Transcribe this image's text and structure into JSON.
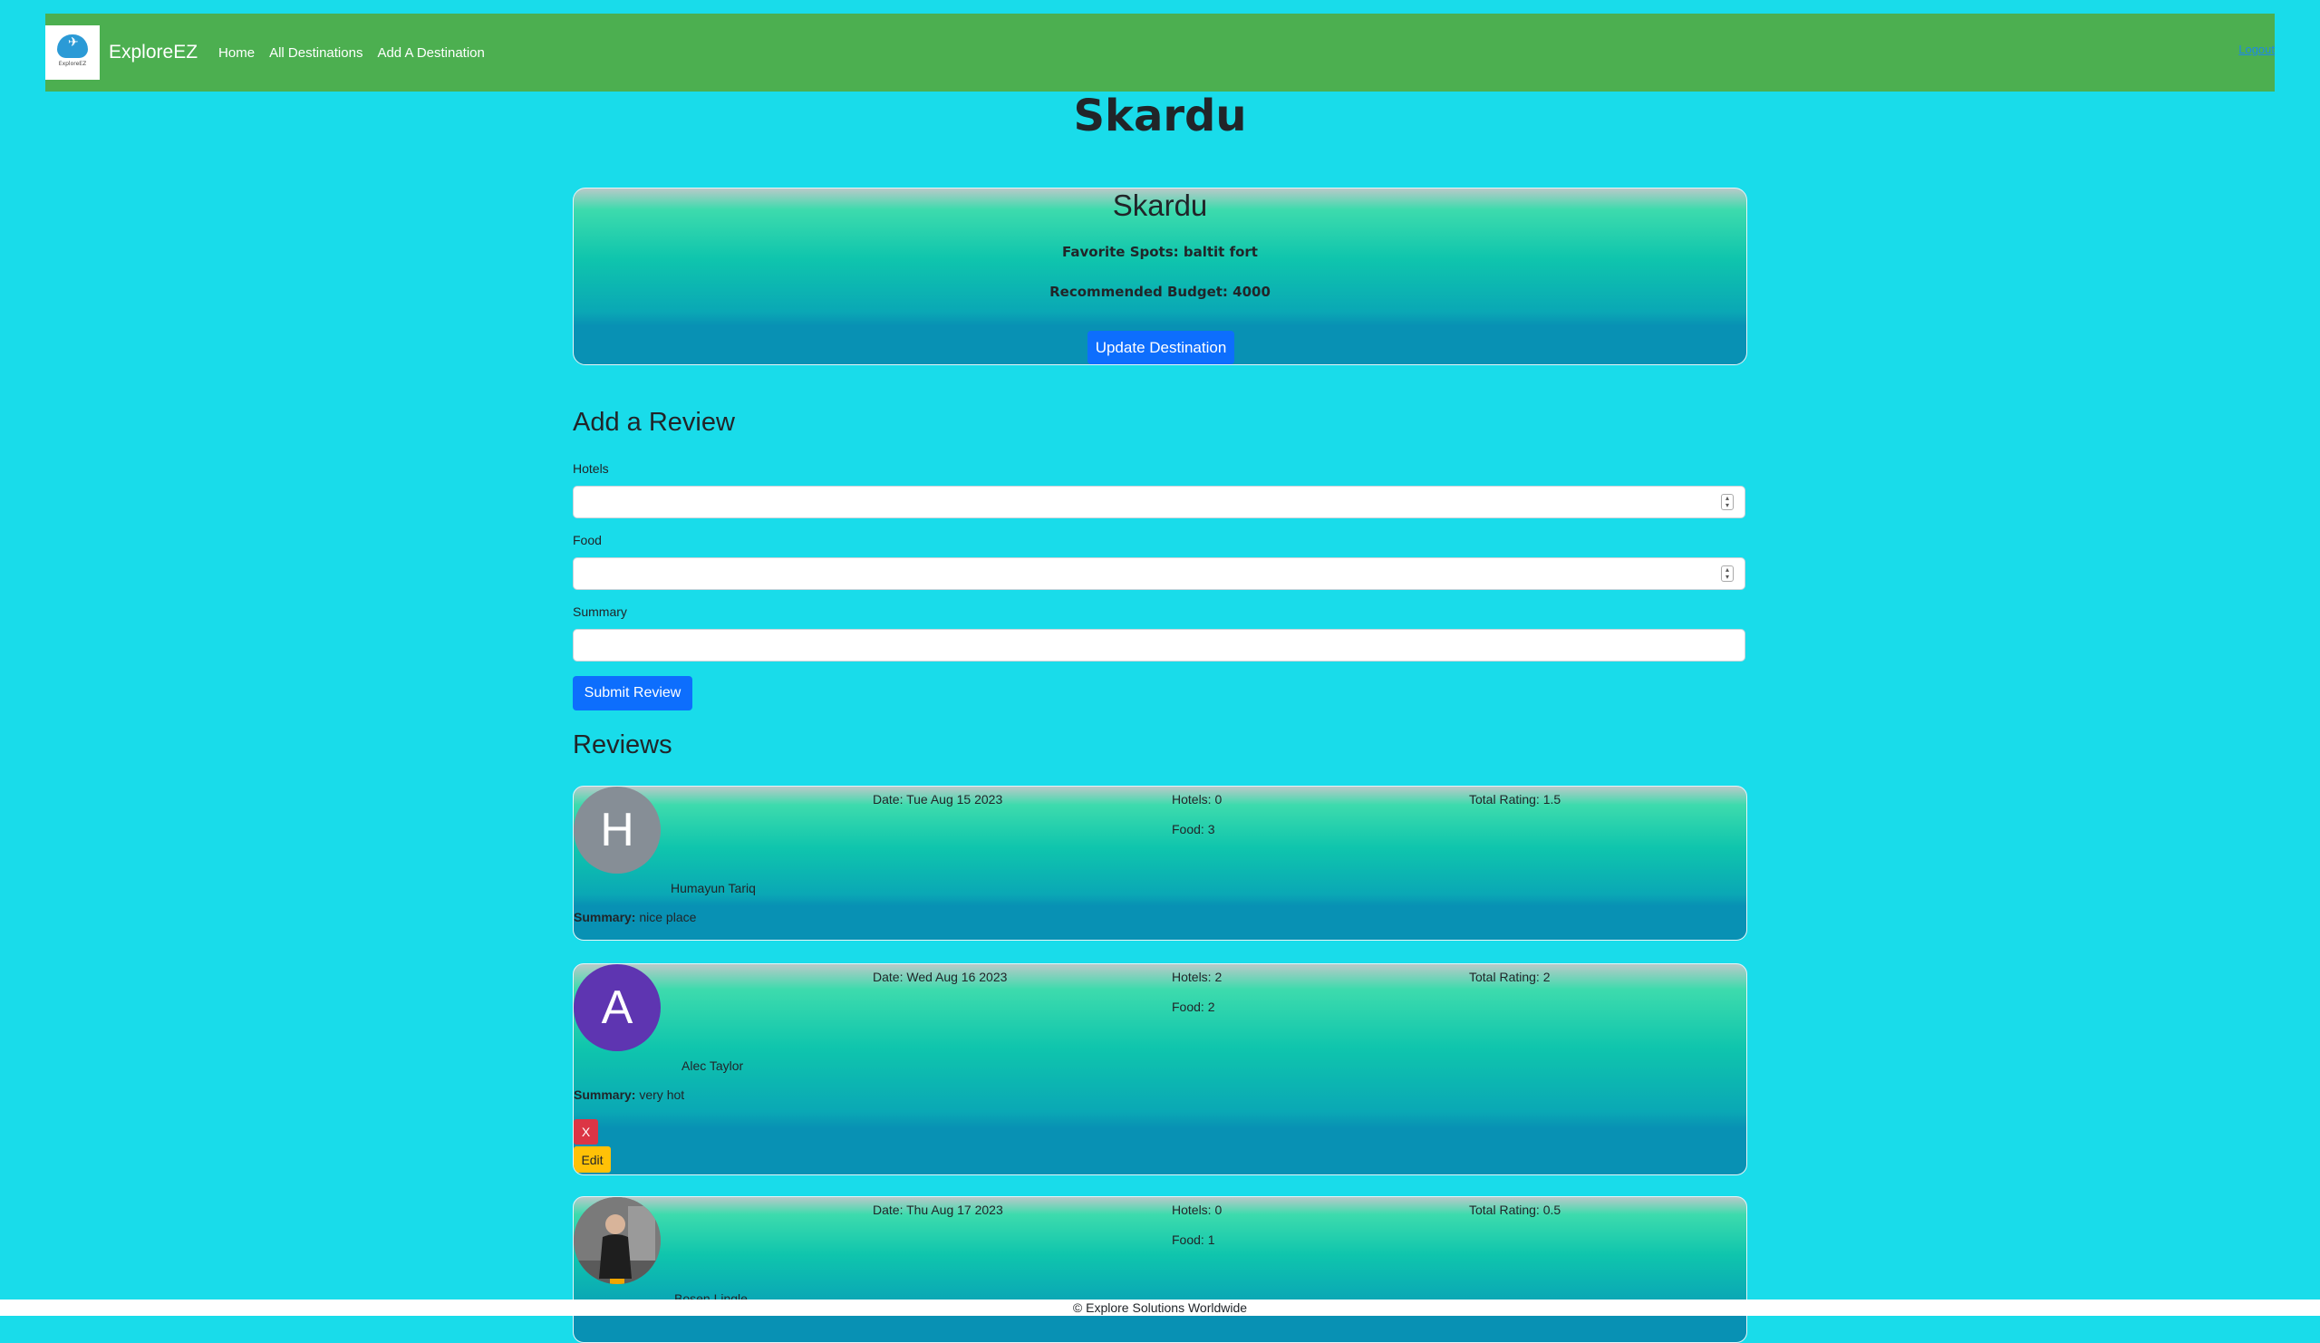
{
  "nav": {
    "brand": "ExploreEZ",
    "logo_text": "ExploreEZ",
    "links": [
      "Home",
      "All Destinations",
      "Add A Destination"
    ],
    "logout": "Logout"
  },
  "page_title": "Skardu",
  "destination": {
    "name": "Skardu",
    "favorite_spots": "Favorite Spots: baltit fort",
    "budget": "Recommended Budget: 4000",
    "update_label": "Update Destination"
  },
  "review_form": {
    "title": "Add a Review",
    "hotels_label": "Hotels",
    "food_label": "Food",
    "summary_label": "Summary",
    "submit_label": "Submit Review"
  },
  "reviews_title": "Reviews",
  "reviews": [
    {
      "avatar_letter": "H",
      "avatar_color": "#868e96",
      "date": "Date: Tue Aug 15 2023",
      "hotels": "Hotels: 0",
      "food": "Food: 3",
      "total": "Total Rating: 1.5",
      "user": "Humayun Tariq",
      "summary_label": "Summary:",
      "summary": " nice place"
    },
    {
      "avatar_letter": "A",
      "avatar_color": "#5e35b1",
      "date": "Date: Wed Aug 16 2023",
      "hotels": "Hotels: 2",
      "food": "Food: 2",
      "total": "Total Rating: 2",
      "user": "Alec Taylor",
      "summary_label": "Summary:",
      "summary": " very hot",
      "delete_label": "X",
      "edit_label": "Edit"
    },
    {
      "date": "Date: Thu Aug 17 2023",
      "hotels": "Hotels: 0",
      "food": "Food: 1",
      "total": "Total Rating: 0.5",
      "user": "Bosen Lingle"
    }
  ],
  "footer": "© Explore Solutions Worldwide"
}
